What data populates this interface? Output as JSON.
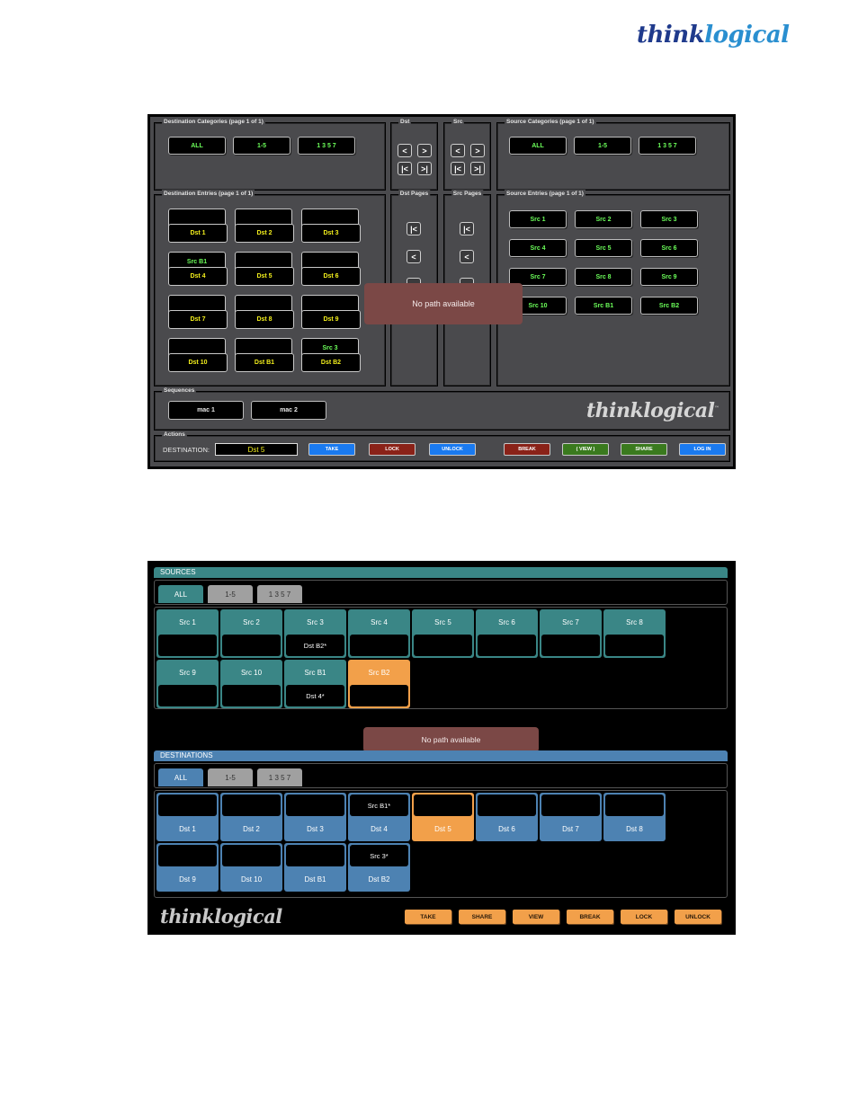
{
  "brand": {
    "think": "think",
    "logical": "logical"
  },
  "legacy": {
    "dest_categories": {
      "title": "Destination Categories (page 1 of 1)",
      "buttons": [
        "ALL",
        "1-5",
        "1 3 5 7"
      ]
    },
    "dst_nav": {
      "title": "Dst",
      "prev": "<",
      "next": ">",
      "first": "|<",
      "last": ">|"
    },
    "src_nav": {
      "title": "Src",
      "prev": "<",
      "next": ">",
      "first": "|<",
      "last": ">|"
    },
    "source_categories": {
      "title": "Source Categories (page 1 of 1)",
      "buttons": [
        "ALL",
        "1-5",
        "1 3 5 7"
      ]
    },
    "dest_entries": {
      "title": "Destination Entries (page 1 of 1)",
      "items": [
        {
          "source": "",
          "name": "Dst 1"
        },
        {
          "source": "",
          "name": "Dst 2"
        },
        {
          "source": "",
          "name": "Dst 3"
        },
        {
          "source": "Src B1",
          "name": "Dst 4"
        },
        {
          "source": "",
          "name": "Dst 5"
        },
        {
          "source": "",
          "name": "Dst 6"
        },
        {
          "source": "",
          "name": "Dst 7"
        },
        {
          "source": "",
          "name": "Dst 8"
        },
        {
          "source": "",
          "name": "Dst 9"
        },
        {
          "source": "",
          "name": "Dst 10"
        },
        {
          "source": "",
          "name": "Dst B1"
        },
        {
          "source": "Src 3",
          "name": "Dst B2"
        }
      ]
    },
    "dst_pages": {
      "title": "Dst Pages",
      "first": "|<",
      "prev": "<"
    },
    "src_pages": {
      "title": "Src Pages",
      "first": "|<",
      "prev": "<"
    },
    "source_entries": {
      "title": "Source Entries (page 1 of 1)",
      "items": [
        "Src 1",
        "Src 2",
        "Src 3",
        "Src 4",
        "Src 5",
        "Src 6",
        "Src 7",
        "Src 8",
        "Src 9",
        "Src 10",
        "Src B1",
        "Src B2"
      ]
    },
    "toast": "No path available",
    "sequences": {
      "title": "Sequences",
      "items": [
        "mac 1",
        "mac 2"
      ]
    },
    "actions": {
      "title": "Actions",
      "destination_label": "DESTINATION:",
      "destination_value": "Dst 5",
      "buttons": [
        {
          "label": "TAKE",
          "color": "#1a7af0"
        },
        {
          "label": "LOCK",
          "color": "#8a2218"
        },
        {
          "label": "UNLOCK",
          "color": "#1a7af0"
        },
        {
          "label": "BREAK",
          "color": "#8a2218"
        },
        {
          "label": "( VIEW )",
          "color": "#3a7a1e"
        },
        {
          "label": "SHARE",
          "color": "#3a7a1e"
        },
        {
          "label": "LOG IN",
          "color": "#1a7af0"
        }
      ]
    },
    "logo": "thinklogical",
    "logo_tm": "™"
  },
  "modern": {
    "sources": {
      "title": "SOURCES",
      "tabs": [
        "ALL",
        "1-5",
        "1 3 5 7"
      ],
      "items": [
        {
          "name": "Src 1",
          "dest": ""
        },
        {
          "name": "Src 2",
          "dest": ""
        },
        {
          "name": "Src 3",
          "dest": "Dst B2*"
        },
        {
          "name": "Src 4",
          "dest": ""
        },
        {
          "name": "Src 5",
          "dest": ""
        },
        {
          "name": "Src 6",
          "dest": ""
        },
        {
          "name": "Src 7",
          "dest": ""
        },
        {
          "name": "Src 8",
          "dest": ""
        },
        {
          "name": "Src 9",
          "dest": ""
        },
        {
          "name": "Src 10",
          "dest": ""
        },
        {
          "name": "Src B1",
          "dest": "Dst 4*"
        },
        {
          "name": "Src B2",
          "dest": "",
          "selected": true
        }
      ]
    },
    "toast": "No path available",
    "destinations": {
      "title": "DESTINATIONS",
      "tabs": [
        "ALL",
        "1-5",
        "1 3 5 7"
      ],
      "items": [
        {
          "name": "Dst 1",
          "source": ""
        },
        {
          "name": "Dst 2",
          "source": ""
        },
        {
          "name": "Dst 3",
          "source": ""
        },
        {
          "name": "Dst 4",
          "source": "Src B1*"
        },
        {
          "name": "Dst 5",
          "source": "",
          "selected": true
        },
        {
          "name": "Dst 6",
          "source": ""
        },
        {
          "name": "Dst 7",
          "source": ""
        },
        {
          "name": "Dst 8",
          "source": ""
        },
        {
          "name": "Dst 9",
          "source": ""
        },
        {
          "name": "Dst 10",
          "source": ""
        },
        {
          "name": "Dst B1",
          "source": ""
        },
        {
          "name": "Dst B2",
          "source": "Src 3*"
        }
      ]
    },
    "logo": "thinklogical",
    "buttons": [
      "TAKE",
      "SHARE",
      "VIEW",
      "BREAK",
      "LOCK",
      "UNLOCK"
    ]
  },
  "colors": {
    "source_teal": "#3a8686",
    "dest_blue": "#4d82b2",
    "selected_orange": "#f2a04a",
    "toast": "#7b4846",
    "legacy_green_text": "#6cff5a",
    "legacy_yellow_text": "#f4f01c"
  }
}
